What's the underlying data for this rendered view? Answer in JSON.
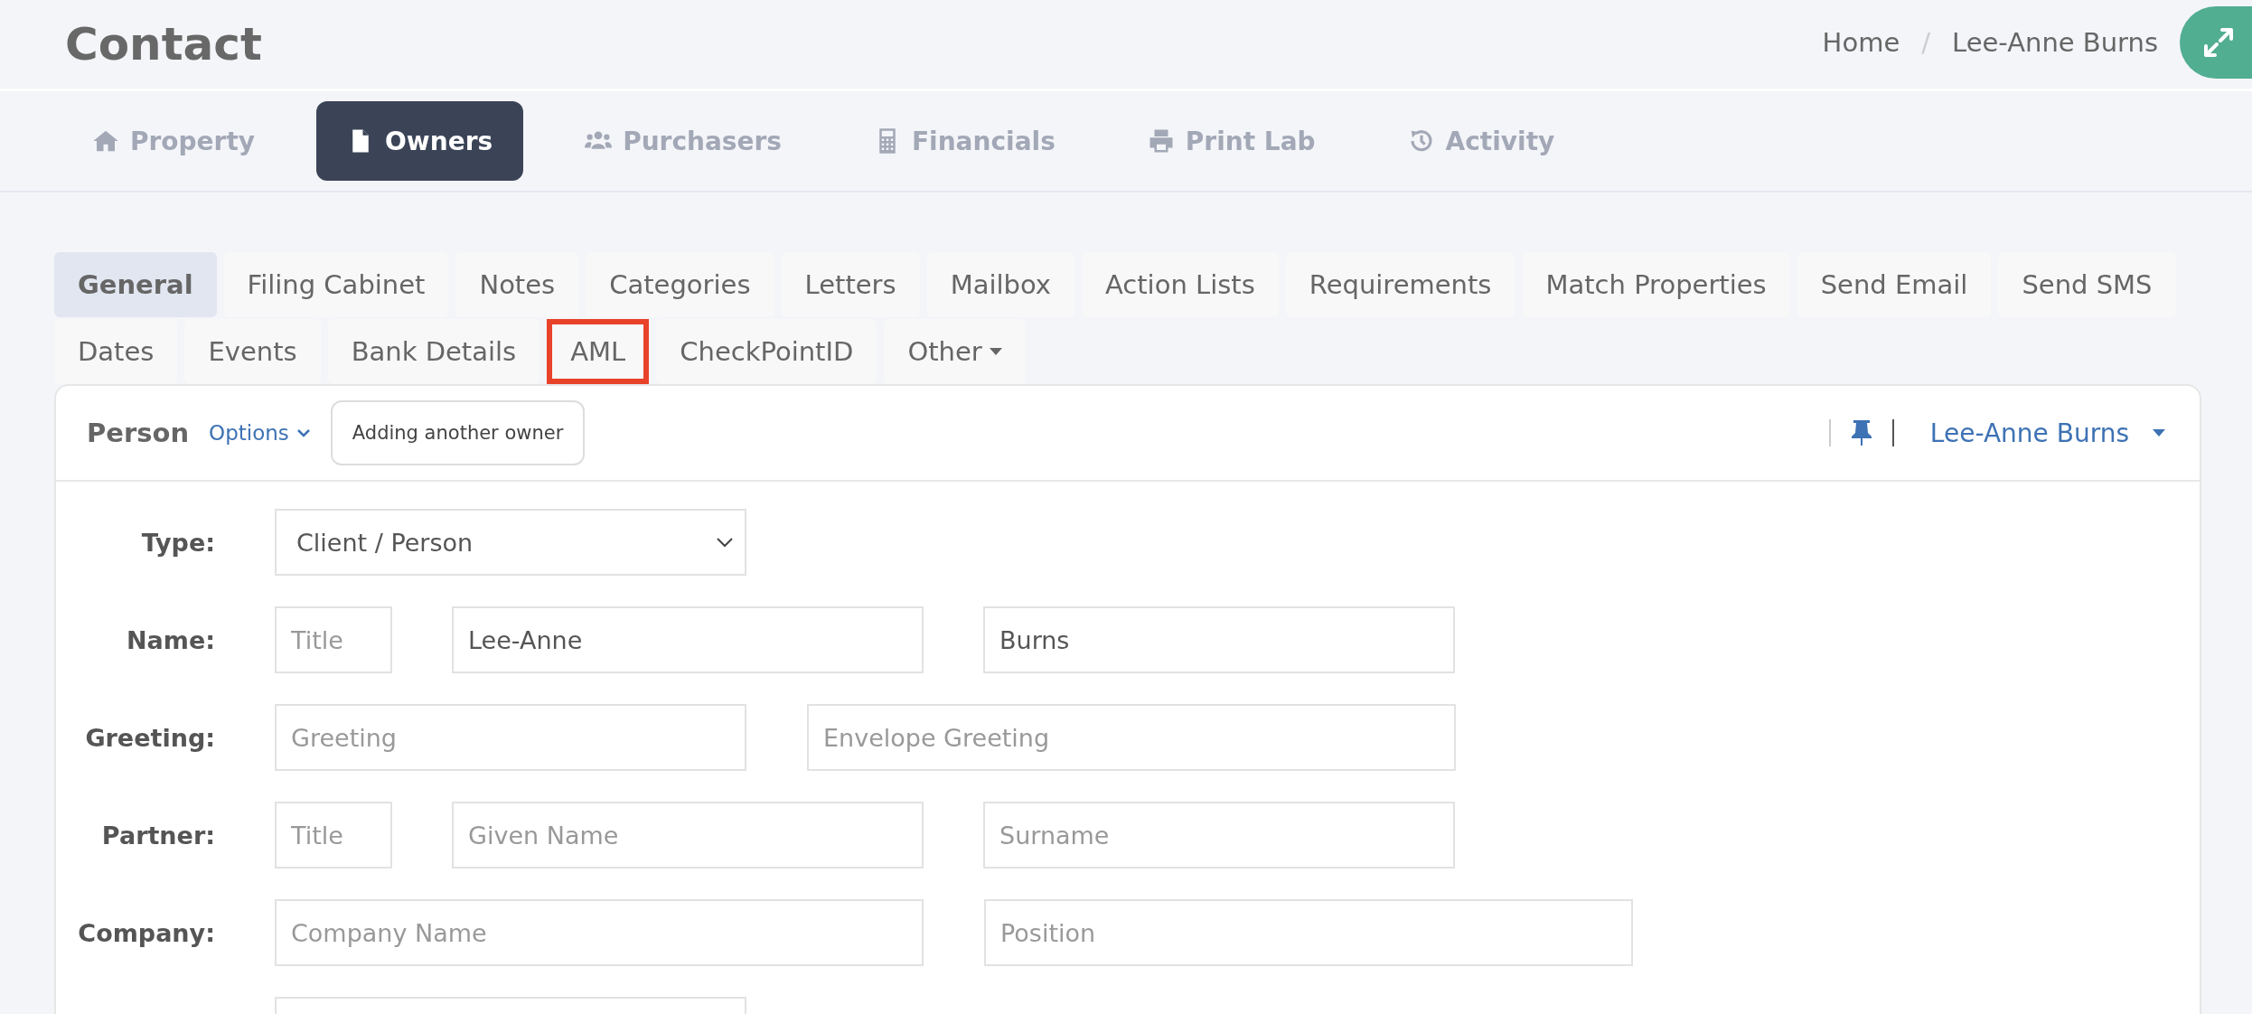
{
  "page": {
    "title": "Contact"
  },
  "breadcrumb": [
    {
      "kind": "link",
      "label": "Home"
    },
    {
      "kind": "separator",
      "label": "/"
    },
    {
      "kind": "link",
      "label": "Lee-Anne Burns"
    }
  ],
  "nav": [
    {
      "label": "Property",
      "selected": false
    },
    {
      "label": "Owners",
      "selected": true
    },
    {
      "label": "Purchasers",
      "selected": false
    },
    {
      "label": "Financials",
      "selected": false
    },
    {
      "label": "Print Lab",
      "selected": false
    },
    {
      "label": "Activity",
      "selected": false
    }
  ],
  "tab_rows": [
    [
      {
        "label": "General",
        "selected": true,
        "highlighted": false
      },
      {
        "label": "Filing Cabinet",
        "selected": false,
        "highlighted": false
      },
      {
        "label": "Notes",
        "selected": false,
        "highlighted": false
      },
      {
        "label": "Categories",
        "selected": false,
        "highlighted": false
      },
      {
        "label": "Letters",
        "selected": false,
        "highlighted": false
      },
      {
        "label": "Mailbox",
        "selected": false,
        "highlighted": false
      },
      {
        "label": "Action Lists",
        "selected": false,
        "highlighted": false
      },
      {
        "label": "Requirements",
        "selected": false,
        "highlighted": false
      },
      {
        "label": "Match Properties",
        "selected": false,
        "highlighted": false
      },
      {
        "label": "Send Email",
        "selected": false,
        "highlighted": false
      },
      {
        "label": "Send SMS",
        "selected": false,
        "highlighted": false
      }
    ],
    [
      {
        "label": "Dates",
        "selected": false,
        "highlighted": false
      },
      {
        "label": "Events",
        "selected": false,
        "highlighted": false
      },
      {
        "label": "Bank Details",
        "selected": false,
        "highlighted": false
      },
      {
        "label": "AML",
        "selected": false,
        "highlighted": true
      },
      {
        "label": "CheckPointID",
        "selected": false,
        "highlighted": false
      },
      {
        "label": "Other",
        "selected": false,
        "highlighted": false,
        "dropdown": true
      }
    ]
  ],
  "card": {
    "title": "Person",
    "options": "Options",
    "action_button": "Adding another owner",
    "contact": "Lee-Anne Burns"
  },
  "form": [
    {
      "label": "Type:",
      "fields": [
        {
          "kind": "select",
          "value": "Client / Person"
        }
      ]
    },
    {
      "label": "Name:",
      "fields": [
        {
          "kind": "input",
          "placeholder": "Title"
        },
        {
          "kind": "input",
          "value": "Lee-Anne"
        },
        {
          "kind": "input",
          "value": "Burns"
        }
      ]
    },
    {
      "label": "Greeting:",
      "fields": [
        {
          "kind": "input",
          "placeholder": "Greeting"
        },
        {
          "kind": "input",
          "placeholder": "Envelope Greeting"
        }
      ]
    },
    {
      "label": "Partner:",
      "fields": [
        {
          "kind": "input",
          "placeholder": "Title"
        },
        {
          "kind": "input",
          "placeholder": "Given Name"
        },
        {
          "kind": "input",
          "placeholder": "Surname"
        }
      ]
    },
    {
      "label": "Company:",
      "fields": [
        {
          "kind": "input",
          "placeholder": "Company Name"
        },
        {
          "kind": "input",
          "placeholder": "Position"
        }
      ]
    },
    {
      "fields": [
        {
          "kind": "input"
        }
      ]
    }
  ]
}
